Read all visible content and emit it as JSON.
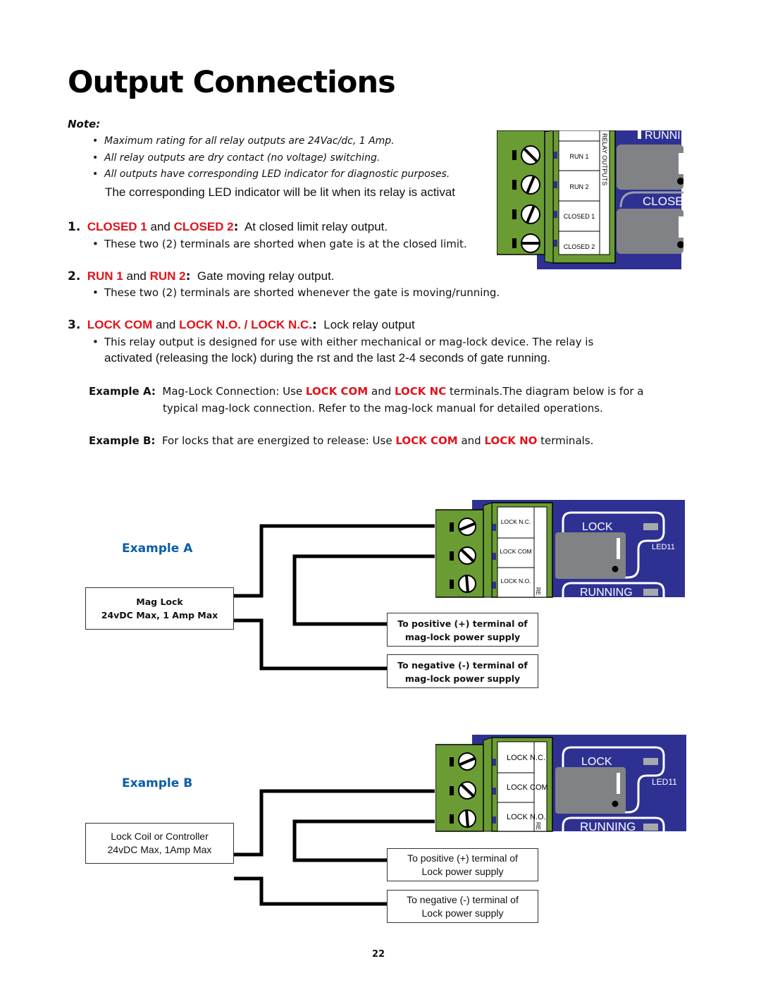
{
  "page": {
    "title": "Output Connections",
    "page_number": "22"
  },
  "note": {
    "label": "Note:",
    "items": [
      "Maximum rating for all relay outputs are 24Vac/dc, 1 Amp.",
      "All relay outputs are dry contact (no voltage) switching.",
      "All outputs have corresponding LED indicator for diagnostic purposes."
    ],
    "continuation": "The corresponding LED indicator will be lit when its relay is activat"
  },
  "sections": [
    {
      "number": "1.",
      "term1": "CLOSED 1",
      "joiner": " and ",
      "term2": "CLOSED 2",
      "colon": ":",
      "description": "At closed limit relay output.",
      "bullet": "These two (2) terminals are shorted when gate is at the closed limit."
    },
    {
      "number": "2.",
      "term1": "RUN 1",
      "joiner": " and ",
      "term2": "RUN 2",
      "colon": ":",
      "description": "Gate moving relay output.",
      "bullet": "These two (2) terminals are shorted whenever the gate is moving/running."
    },
    {
      "number": "3.",
      "term1": "LOCK COM",
      "joiner": " and ",
      "term2": "LOCK N.O. / LOCK N.C.",
      "colon": ":",
      "description": "Lock relay output",
      "bullet_line1": "This relay output is designed for use with either mechanical or mag-lock device. The relay is",
      "bullet_line2": "activated (releasing the lock) during the  rst and the last 2-4 seconds of gate running."
    }
  ],
  "examples_text": {
    "a": {
      "label": "Example A:",
      "pre": "Mag-Lock Connection:  Use ",
      "term1": "LOCK COM",
      "joiner": " and ",
      "term2": "LOCK NC",
      "post": " terminals.The diagram below is for a",
      "line2": "typical mag-lock connection. Refer to the mag-lock manual for detailed operations."
    },
    "b": {
      "label": "Example B:",
      "pre": "For locks that are energized to release:  Use ",
      "term1": "LOCK COM",
      "joiner": " and ",
      "term2": "LOCK NO",
      "post": " terminals."
    }
  },
  "top_diagram": {
    "terminals": [
      "RUN 1",
      "RUN 2",
      "CLOSED 1",
      "CLOSED 2"
    ],
    "side_label": "RELAY OUTPUTS",
    "led_labels": [
      "RUNNI",
      "CLOSE"
    ]
  },
  "example_a": {
    "heading": "Example A",
    "device_box": [
      "Mag Lock",
      "24vDC Max, 1 Amp Max"
    ],
    "positive_box": [
      "To positive (+) terminal of",
      "mag-lock power supply"
    ],
    "negative_box": [
      "To negative (-) terminal of",
      "mag-lock power supply"
    ],
    "terminals": [
      "LOCK N.C.",
      "LOCK COM",
      "LOCK N.O."
    ],
    "side_label": "RE",
    "led_labels": {
      "lock": "LOCK",
      "running": "RUNNING",
      "led_id": "LED11"
    }
  },
  "example_b": {
    "heading": "Example B",
    "device_box": [
      "Lock Coil or Controller",
      "24vDC Max, 1Amp Max"
    ],
    "positive_box": [
      "To positive (+) terminal of",
      "Lock power supply"
    ],
    "negative_box": [
      "To negative (-) terminal of",
      "Lock power supply"
    ],
    "terminals": [
      "LOCK N.C.",
      "LOCK COM",
      "LOCK N.O."
    ],
    "side_label": "RE",
    "led_labels": {
      "lock": "LOCK",
      "running": "RUNNING",
      "led_id": "LED11"
    }
  },
  "colors": {
    "emphasis_red": "#e3121b",
    "heading_blue": "#0a5ea8",
    "board_blue": "#2e3192",
    "connector_green": "#6a9c33",
    "relay_gray": "#808285"
  }
}
